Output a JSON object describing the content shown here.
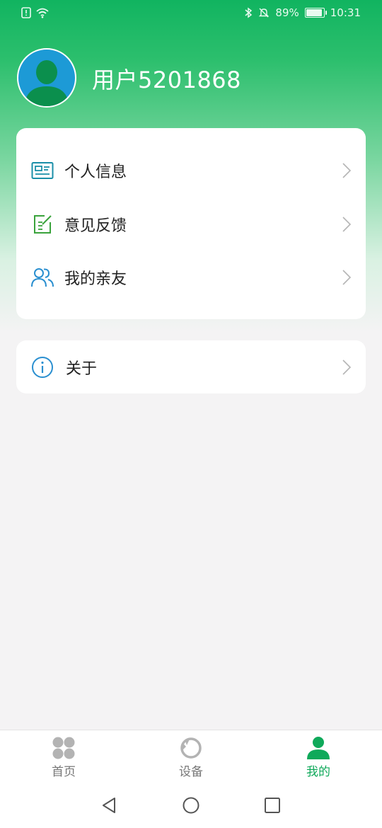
{
  "status_bar": {
    "battery": "89%",
    "time": "10:31"
  },
  "profile": {
    "username": "用户5201868"
  },
  "menu": {
    "items": [
      {
        "label": "个人信息",
        "icon": "id-card-icon"
      },
      {
        "label": "意见反馈",
        "icon": "feedback-edit-icon"
      },
      {
        "label": "我的亲友",
        "icon": "friends-icon"
      }
    ],
    "about": {
      "label": "关于",
      "icon": "info-icon"
    }
  },
  "bottom_nav": {
    "items": [
      {
        "label": "首页",
        "icon": "home-clover-icon",
        "active": false
      },
      {
        "label": "设备",
        "icon": "device-ring-icon",
        "active": false
      },
      {
        "label": "我的",
        "icon": "person-icon",
        "active": true
      }
    ]
  },
  "colors": {
    "primary": "#0fa95a",
    "avatar_bg": "#1d9ad6",
    "inactive": "#777777"
  }
}
